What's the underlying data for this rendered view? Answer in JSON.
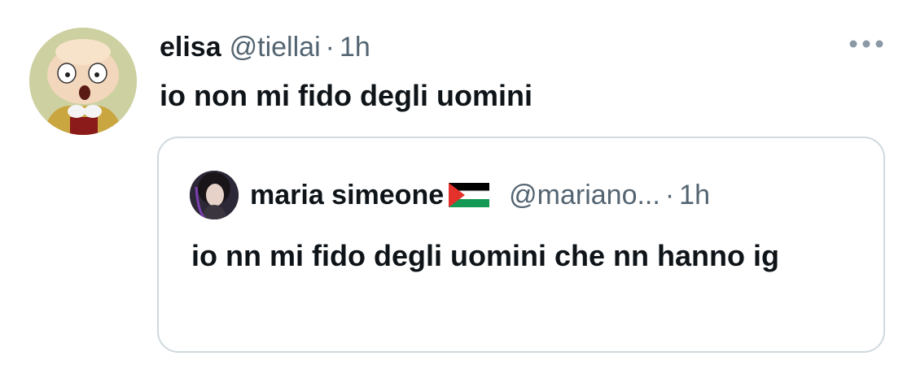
{
  "tweet": {
    "display_name": "elisa",
    "handle": "@tiellai",
    "separator": "·",
    "time": "1h",
    "text": "io non mi fido degli uomini",
    "more_icon": "more-horizontal-icon"
  },
  "quote": {
    "display_name": "maria simeone",
    "flag_icon": "palestine-flag-icon",
    "handle": "@mariano...",
    "separator": "·",
    "time": "1h",
    "text": "io nn mi fido degli uomini che nn hanno ig"
  },
  "colors": {
    "text_primary": "#0f1419",
    "text_secondary": "#536471",
    "border": "#cfd9de",
    "background": "#ffffff"
  }
}
